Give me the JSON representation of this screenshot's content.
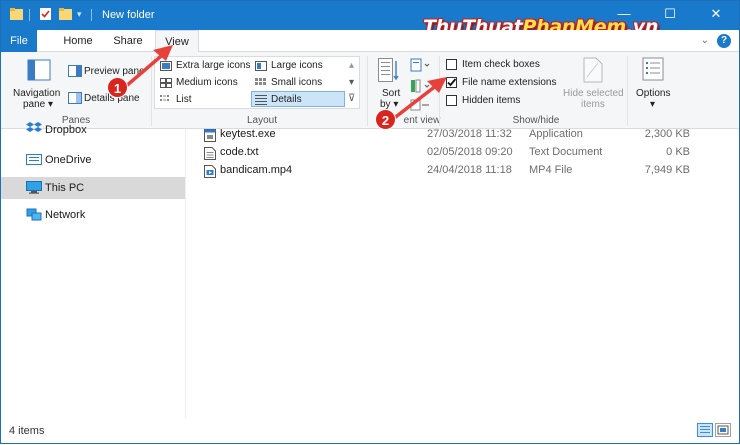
{
  "window": {
    "title": "New folder",
    "minimize_glyph": "—",
    "maximize_glyph": "☐",
    "close_glyph": "✕"
  },
  "brand": {
    "part1": "ThuThuat",
    "part2": "PhanMem",
    "part3": ".vn"
  },
  "tabs": [
    {
      "label": "File"
    },
    {
      "label": "Home"
    },
    {
      "label": "Share"
    },
    {
      "label": "View"
    }
  ],
  "ribbon": {
    "panes": {
      "navigation_pane_line1": "Navigation",
      "navigation_pane_line2": "pane ▾",
      "preview_pane": "Preview pane",
      "details_pane": "Details pane",
      "group_label": "Panes"
    },
    "layout": {
      "extra_large_icons": "Extra large icons",
      "large_icons": "Large icons",
      "medium_icons": "Medium icons",
      "small_icons": "Small icons",
      "list": "List",
      "details": "Details",
      "group_label": "Layout"
    },
    "current_view": {
      "sort_by_line1": "Sort",
      "sort_by_line2": "by ▾",
      "group_label": "Current view",
      "group_label_visible": "ent view"
    },
    "show_hide": {
      "item_check_boxes": "Item check boxes",
      "item_check_boxes_checked": false,
      "file_name_extensions": "File name extensions",
      "file_name_extensions_checked": true,
      "hidden_items": "Hidden items",
      "hidden_items_checked": false,
      "hide_selected_line1": "Hide selected",
      "hide_selected_line2": "items",
      "group_label": "Show/hide"
    },
    "options": {
      "label": "Options",
      "arrow": "▾"
    }
  },
  "badges": {
    "one": "1",
    "two": "2"
  },
  "nav": {
    "items": [
      {
        "label": "Dropbox",
        "icon": "dropbox-icon"
      },
      {
        "label": "OneDrive",
        "icon": "onedrive-icon"
      },
      {
        "label": "This PC",
        "icon": "this-pc-icon",
        "selected": true
      },
      {
        "label": "Network",
        "icon": "network-icon"
      }
    ]
  },
  "files": [
    {
      "name": "keytest.exe",
      "date": "27/03/2018 11:32",
      "type": "Application",
      "size": "2,300 KB",
      "icon": "exe-icon"
    },
    {
      "name": "code.txt",
      "date": "02/05/2018 09:20",
      "type": "Text Document",
      "size": "0 KB",
      "icon": "txt-icon"
    },
    {
      "name": "bandicam.mp4",
      "date": "24/04/2018 11:18",
      "type": "MP4 File",
      "size": "7,949 KB",
      "icon": "mp4-icon"
    }
  ],
  "status": {
    "item_count": "4 items"
  },
  "colors": {
    "titlebar": "#1979ca",
    "ribbon_bg": "#f5f6f7",
    "selection": "#d9d9d9",
    "badge_red": "#d9251d",
    "arrow_red": "#e8413b"
  }
}
